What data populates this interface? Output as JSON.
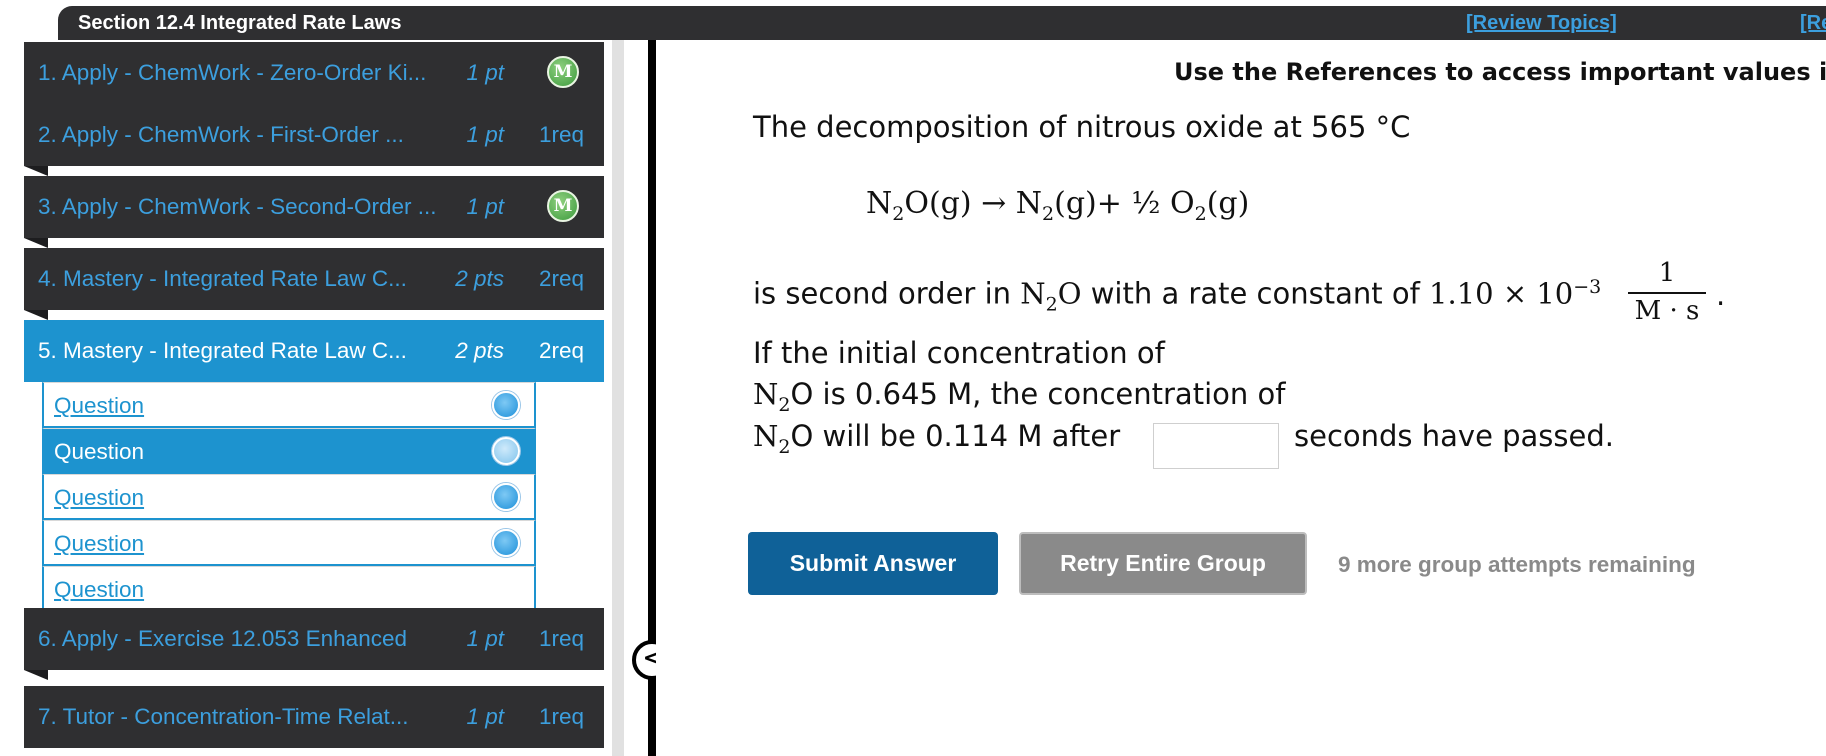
{
  "header": {
    "section_title": "Section 12.4 Integrated Rate Laws",
    "review_topics": "[Review Topics]",
    "references_clipped": "[Re"
  },
  "sidebar": {
    "items": [
      {
        "title": "1. Apply - ChemWork - Zero-Order Ki...",
        "points": "1 pt",
        "badge": "M"
      },
      {
        "title": "2. Apply - ChemWork - First-Order ...",
        "points": "1 pt",
        "req": "1req"
      },
      {
        "title": "3. Apply - ChemWork - Second-Order ...",
        "points": "1 pt",
        "badge": "M"
      },
      {
        "title": "4. Mastery - Integrated Rate Law C...",
        "points": "2 pts",
        "req": "2req"
      },
      {
        "title": "5. Mastery - Integrated Rate Law C...",
        "points": "2 pts",
        "req": "2req",
        "active": true
      },
      {
        "title": "6. Apply - Exercise 12.053 Enhanced",
        "points": "1 pt",
        "req": "1req"
      },
      {
        "title": "7. Tutor - Concentration-Time Relat...",
        "points": "1 pt",
        "req": "1req"
      }
    ],
    "subquestions": [
      "Question",
      "Question",
      "Question",
      "Question",
      "Question"
    ],
    "collapse_glyph": "<"
  },
  "main": {
    "references_note": "Use the References to access important values if",
    "intro": "The decomposition of nitrous oxide at 565 °C",
    "equation": {
      "reactant": "N",
      "reactant_sub": "2",
      "reactant_tail": "O(g) → N",
      "product1_sub": "2",
      "product1_tail": "(g)+ ½ O",
      "product2_sub": "2",
      "product2_tail": "(g)"
    },
    "order_text_1": "is second order in ",
    "order_species": "N",
    "order_species_sub": "2",
    "order_species_tail": "O",
    "order_text_2": " with a rate constant of ",
    "rate_constant": "1.10 × 10",
    "rate_exponent": "−3",
    "units_num": "1",
    "units_den": "M · s",
    "period": ".",
    "cond_line1": "If the initial concentration of",
    "cond_line2_tail": "O is 0.645 M, the concentration of",
    "cond_line3_tail": "O will be 0.114 M after",
    "cond_line3_end": "seconds have passed.",
    "species_head": "N",
    "species_sub": "2",
    "answer_value": ""
  },
  "actions": {
    "submit": "Submit Answer",
    "retry": "Retry Entire Group",
    "attempts": "9 more group attempts remaining"
  },
  "colors": {
    "accent_blue": "#1d93cf",
    "submit_blue": "#0f6198",
    "dark_bar": "#2f2f31",
    "retry_gray": "#8a8a8a"
  }
}
